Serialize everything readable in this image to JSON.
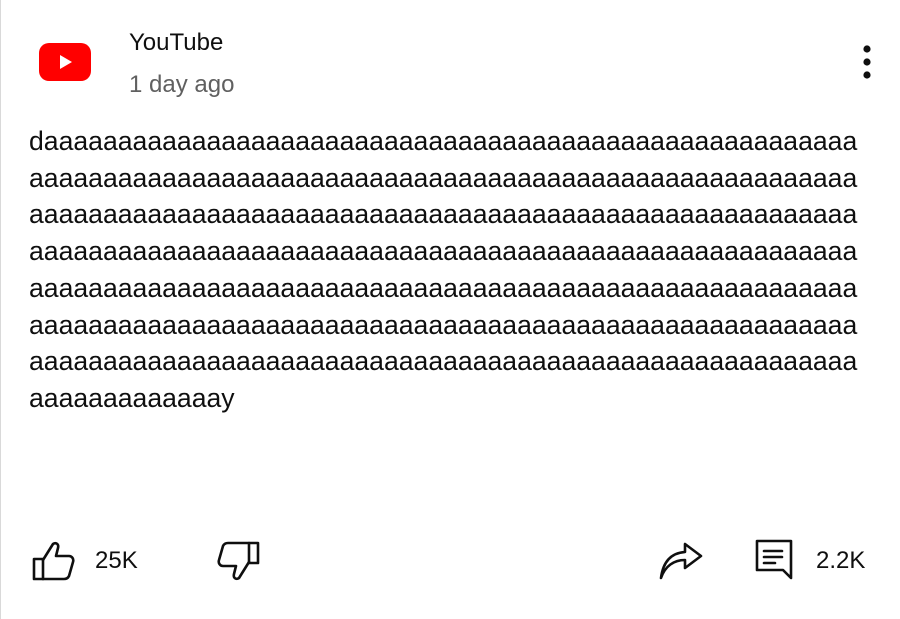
{
  "post": {
    "channel_name": "YouTube",
    "timestamp": "1 day ago",
    "text": "daaaaaaaaaaaaaaaaaaaaaaaaaaaaaaaaaaaaaaaaaaaaaaaaaaaaaaaaaaaaaaaaaaaaaaaaaaaaaaaaaaaaaaaaaaaaaaaaaaaaaaaaaaaaaaaaaaaaaaaaaaaaaaaaaaaaaaaaaaaaaaaaaaaaaaaaaaaaaaaaaaaaaaaaaaaaaaaaaaaaaaaaaaaaaaaaaaaaaaaaaaaaaaaaaaaaaaaaaaaaaaaaaaaaaaaaaaaaaaaaaaaaaaaaaaaaaaaaaaaaaaaaaaaaaaaaaaaaaaaaaaaaaaaaaaaaaaaaaaaaaaaaaaaaaaaaaaaaaaaaaaaaaaaaaaaaaaaaaaaaaaaaaaaaaaaaaaaaaaaaaaaaaaaaaaaaaaaaaaaaaaaaaaaaaaaaaaaaaaaaaaaay"
  },
  "actions": {
    "like_count": "25K",
    "comments_count": "2.2K"
  },
  "icons": {
    "avatar": "youtube-logo-icon",
    "menu": "more-vertical-icon",
    "like": "thumbs-up-icon",
    "dislike": "thumbs-down-icon",
    "share": "share-icon",
    "comments": "comment-icon"
  },
  "colors": {
    "brand": "#ff0000",
    "text": "#0f0f0f",
    "secondary_text": "#606060"
  }
}
